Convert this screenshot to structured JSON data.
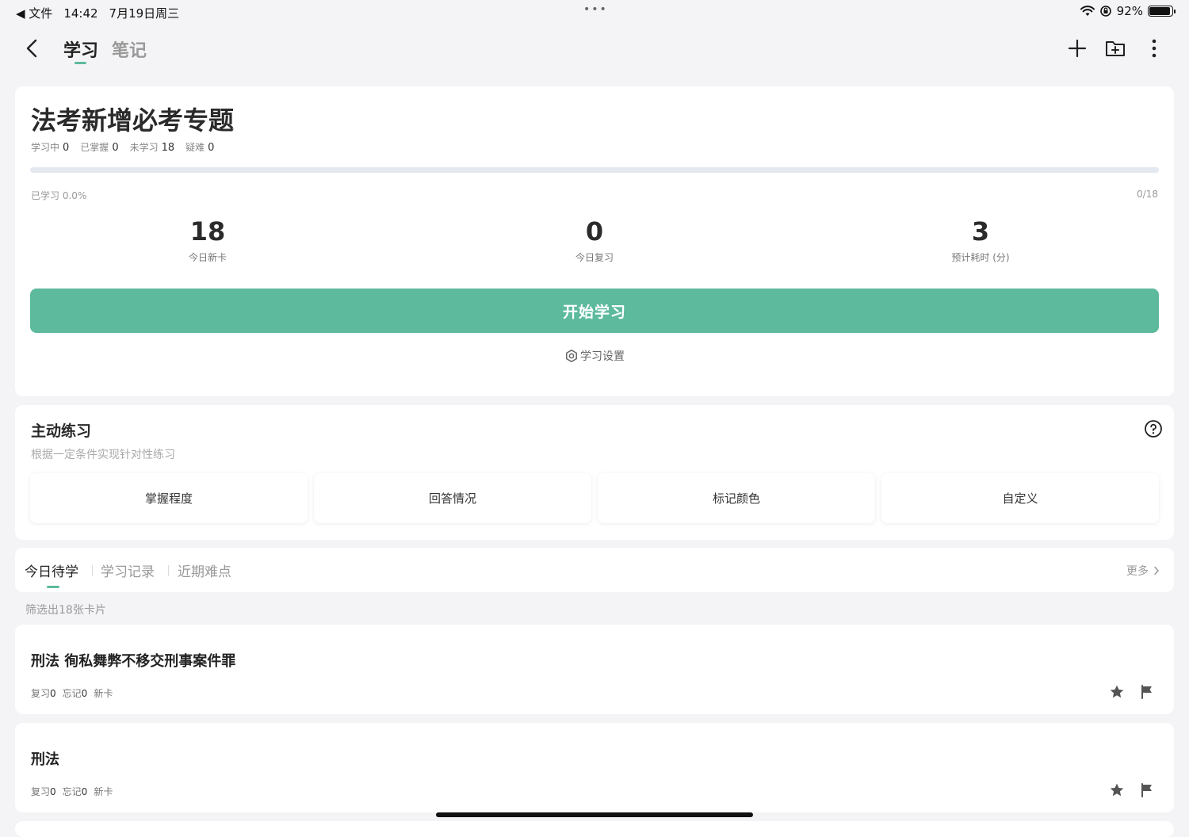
{
  "status_bar": {
    "back_app": "◀ 文件",
    "time": "14:42",
    "date": "7月19日周三",
    "dots": "•••",
    "battery": "92%",
    "battery_level": 0.92
  },
  "nav": {
    "tabs": [
      {
        "label": "学习",
        "active": true
      },
      {
        "label": "笔记",
        "active": false
      }
    ]
  },
  "deck": {
    "title": "法考新增必考专题",
    "stats": [
      {
        "label": "学习中",
        "value": "0"
      },
      {
        "label": "已掌握",
        "value": "0"
      },
      {
        "label": "未学习",
        "value": "18"
      },
      {
        "label": "疑难",
        "value": "0"
      }
    ],
    "progress_label": "已学习 0.0%",
    "progress_count": "0/18",
    "progress_fraction": 0.0,
    "metrics": [
      {
        "value": "18",
        "label": "今日新卡"
      },
      {
        "value": "0",
        "label": "今日复习"
      },
      {
        "value": "3",
        "label": "预计耗时 (分)"
      }
    ],
    "start_button": "开始学习",
    "settings_link": "学习设置"
  },
  "practice": {
    "title": "主动练习",
    "subtitle": "根据一定条件实现针对性练习",
    "filters": [
      "掌握程度",
      "回答情况",
      "标记颜色",
      "自定义"
    ]
  },
  "list_tabs": {
    "tabs": [
      {
        "label": "今日待学",
        "active": true
      },
      {
        "label": "学习记录",
        "active": false
      },
      {
        "label": "近期难点",
        "active": false
      }
    ],
    "more": "更多"
  },
  "filter_count": "筛选出18张卡片",
  "cards": [
    {
      "title": "刑法 徇私舞弊不移交刑事案件罪",
      "review": "复习",
      "review_count": "0",
      "forget": "忘记",
      "forget_count": "0",
      "status": "新卡"
    },
    {
      "title": "刑法",
      "review": "复习",
      "review_count": "0",
      "forget": "忘记",
      "forget_count": "0",
      "status": "新卡"
    }
  ],
  "colors": {
    "accent": "#5dba9d",
    "background": "#f4f4f6",
    "card": "#ffffff"
  }
}
